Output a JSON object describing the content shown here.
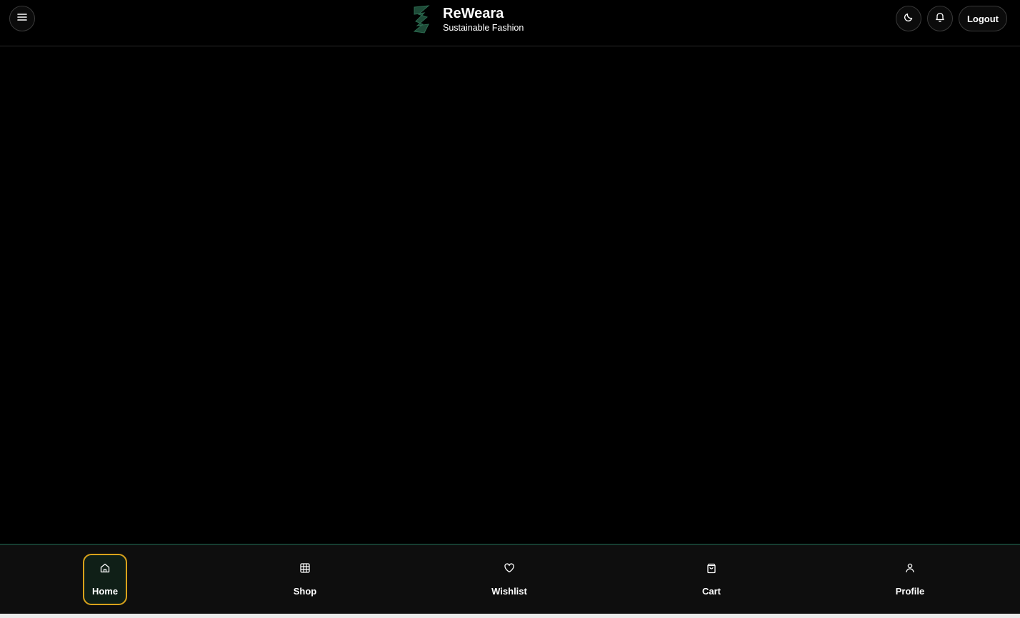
{
  "header": {
    "brand_title": "ReWeara",
    "brand_subtitle": "Sustainable Fashion",
    "logout_label": "Logout",
    "icons": [
      "menu-icon",
      "moon-icon",
      "bell-icon"
    ]
  },
  "bottom_nav": {
    "active": "Home",
    "items": [
      {
        "label": "Home",
        "icon": "home-icon"
      },
      {
        "label": "Shop",
        "icon": "grid-icon"
      },
      {
        "label": "Wishlist",
        "icon": "heart-icon"
      },
      {
        "label": "Cart",
        "icon": "shopping-bag-icon"
      },
      {
        "label": "Profile",
        "icon": "user-icon"
      }
    ]
  },
  "colors": {
    "background": "#000000",
    "active_border": "#d9a21b",
    "nav_divider": "#1f6d55",
    "logo": "#1d4a37"
  }
}
